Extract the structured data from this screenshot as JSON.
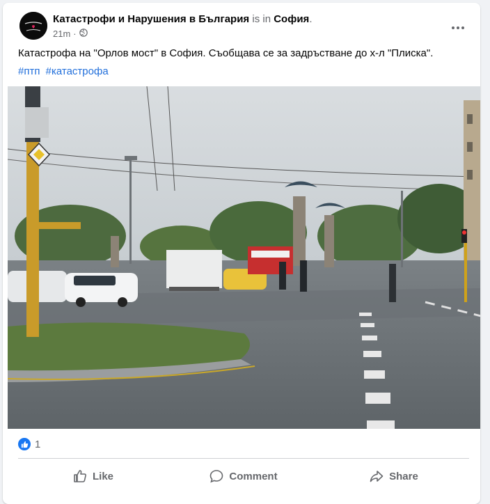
{
  "post": {
    "page_name": "Катастрофи и Нарушения в България",
    "connector": "is in",
    "location": "София",
    "separator": ".",
    "time": "21m",
    "middot": "·",
    "privacy_icon": "globe-icon",
    "more_icon": "more-dots-icon",
    "text": "Катастрофа на \"Орлов мост\" в София. Съобщава се за задръстване до х-л \"Плиска\".",
    "hashtags": [
      "#птп",
      "#катастрофа"
    ]
  },
  "reactions": {
    "icon": "like-icon",
    "count": "1"
  },
  "actions": {
    "like": {
      "label": "Like",
      "icon": "thumbs-up-icon"
    },
    "comment": {
      "label": "Comment",
      "icon": "comment-icon"
    },
    "share": {
      "label": "Share",
      "icon": "share-icon"
    }
  },
  "colors": {
    "link": "#216fdb",
    "muted": "#65676b",
    "like_blue": "#1877f2",
    "background": "#f0f2f5"
  }
}
